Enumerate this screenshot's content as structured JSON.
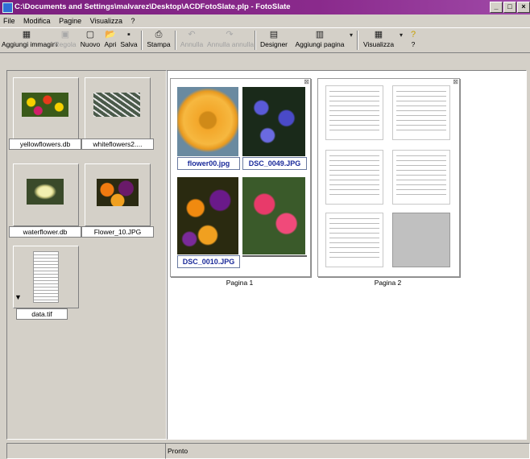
{
  "window": {
    "title": "C:\\Documents and Settings\\malvarez\\Desktop\\ACDFotoSlate.plp - FotoSlate",
    "buttons": {
      "minimize": "_",
      "maximize": "□",
      "close": "×"
    }
  },
  "menu": [
    "File",
    "Modifica",
    "Pagine",
    "Visualizza",
    "?"
  ],
  "toolbar": {
    "aggiungi_immagini": "Aggiungi immagini",
    "regola": "Regola",
    "nuovo": "Nuovo",
    "apri": "Apri",
    "salva": "Salva",
    "stampa": "Stampa",
    "annulla": "Annulla",
    "annulla_annulla": "Annulla annulla",
    "designer": "Designer",
    "aggiungi_pagina": "Aggiungi pagina",
    "visualizza": "Visualizza",
    "help": "?"
  },
  "sidebar": {
    "thumbnails": [
      {
        "caption": "yellowflowers.db",
        "icon": "flowers-image-icon"
      },
      {
        "caption": "whiteflowers2....",
        "icon": "white-flower-image-icon"
      },
      {
        "caption": "waterflower.db",
        "icon": "water-lily-image-icon"
      },
      {
        "caption": "Flower_10.JPG",
        "icon": "pansy-image-icon"
      },
      {
        "caption": "data.tif",
        "icon": "document-image-icon"
      }
    ]
  },
  "pages": [
    {
      "label": "Pagina 1",
      "photos": [
        "flower00.jpg",
        "DSC_0049.JPG",
        "DSC_0010.JPG",
        ""
      ]
    },
    {
      "label": "Pagina 2"
    }
  ],
  "status": {
    "left": "",
    "right": "Pronto"
  },
  "colors": {
    "titlebar": "#7b1f7e",
    "caption_text": "#1a2a9a",
    "window_bg": "#d4d0c8"
  }
}
